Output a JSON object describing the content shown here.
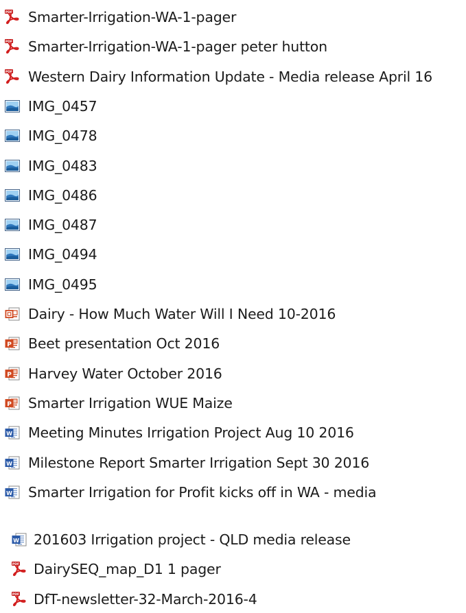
{
  "file_list": {
    "items": [
      {
        "name": "Smarter-Irrigation-WA-1-pager",
        "type": "pdf",
        "icon": "pdf-icon"
      },
      {
        "name": "Smarter-Irrigation-WA-1-pager peter hutton",
        "type": "pdf",
        "icon": "pdf-icon"
      },
      {
        "name": "Western Dairy Information Update - Media release April 16",
        "type": "pdf",
        "icon": "pdf-icon"
      },
      {
        "name": "IMG_0457",
        "type": "image",
        "icon": "image-icon"
      },
      {
        "name": "IMG_0478",
        "type": "image",
        "icon": "image-icon"
      },
      {
        "name": "IMG_0483",
        "type": "image",
        "icon": "image-icon"
      },
      {
        "name": "IMG_0486",
        "type": "image",
        "icon": "image-icon"
      },
      {
        "name": "IMG_0487",
        "type": "image",
        "icon": "image-icon"
      },
      {
        "name": "IMG_0494",
        "type": "image",
        "icon": "image-icon"
      },
      {
        "name": "IMG_0495",
        "type": "image",
        "icon": "image-icon"
      },
      {
        "name": "Dairy -  How Much Water Will I Need  10-2016",
        "type": "slideshow",
        "icon": "powerpoint-show-icon"
      },
      {
        "name": "Beet presentation Oct 2016",
        "type": "presentation",
        "icon": "powerpoint-icon"
      },
      {
        "name": "Harvey Water October 2016",
        "type": "presentation",
        "icon": "powerpoint-icon"
      },
      {
        "name": "Smarter Irrigation WUE Maize",
        "type": "presentation",
        "icon": "powerpoint-icon"
      },
      {
        "name": "Meeting Minutes Irrigation Project Aug 10 2016",
        "type": "word",
        "icon": "word-icon"
      },
      {
        "name": "Milestone Report Smarter Irrigation Sept 30 2016",
        "type": "word",
        "icon": "word-icon"
      },
      {
        "name": "Smarter Irrigation for Profit kicks off in WA - media",
        "type": "word",
        "icon": "word-icon"
      }
    ]
  },
  "file_list_secondary": {
    "items": [
      {
        "name": "201603 Irrigation project - QLD media release",
        "type": "word",
        "icon": "word-icon"
      },
      {
        "name": "DairySEQ_map_D1 1 pager",
        "type": "pdf",
        "icon": "pdf-icon"
      },
      {
        "name": "DfT-newsletter-32-March-2016-4",
        "type": "pdf",
        "icon": "pdf-icon"
      }
    ]
  },
  "colors": {
    "pdf_red": "#d21e1e",
    "powerpoint_orange": "#d04a22",
    "word_blue": "#2b5aa8",
    "image_blue": "#3d7fc4",
    "separator": "#f0f0f0"
  }
}
